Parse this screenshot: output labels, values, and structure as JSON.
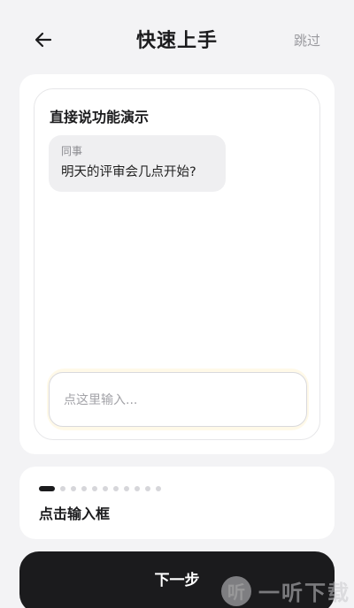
{
  "header": {
    "title": "快速上手",
    "skip_label": "跳过",
    "back_icon": "arrow-left-icon"
  },
  "demo": {
    "title": "直接说功能演示",
    "message": {
      "sender": "同事",
      "text": "明天的评审会几点开始?"
    },
    "input_placeholder": "点这里输入..."
  },
  "steps": {
    "total": 11,
    "current": 1,
    "label": "点击输入框"
  },
  "primary_button": {
    "label": "下一步"
  },
  "watermark": {
    "logo_char": "听",
    "text": "一听下载"
  },
  "colors": {
    "background": "#f3f3f5",
    "card": "#ffffff",
    "accent_dark": "#1b1b1d",
    "muted": "#9a9a9f"
  }
}
